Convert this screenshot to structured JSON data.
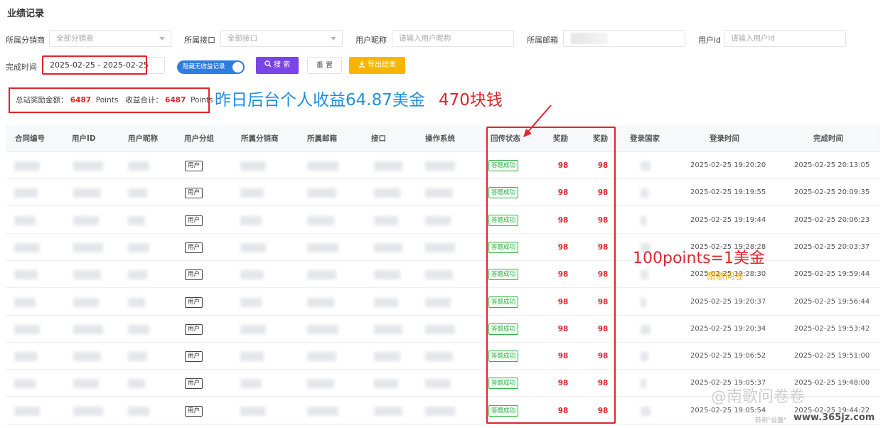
{
  "page_title": "业绩记录",
  "filters": {
    "distributor_label": "所属分销商",
    "distributor_value": "全部分销商",
    "interface_label": "所属接口",
    "interface_value": "全部接口",
    "nickname_label": "用户昵称",
    "nickname_placeholder": "请输入用户昵称",
    "email_label": "所属邮箱",
    "userid_label": "用户id",
    "userid_placeholder": "请输入用户id",
    "finish_time_label": "完成时间",
    "date_range": "2025-02-25 - 2025-02-25",
    "toggle_label": "隐藏无收益记录",
    "search_button": "搜 索",
    "reset_button": "重 置",
    "export_button": "导出结果"
  },
  "summary": {
    "total_label": "总站奖励金额：",
    "total_value": "6487",
    "total_unit": "Points",
    "income_label": "收益合计：",
    "income_value": "6487",
    "income_unit": "Points"
  },
  "annotations": {
    "blue_note": "昨日后台个人收益64.87美金",
    "red_note": "470块钱",
    "points_note": "100points=1美金"
  },
  "watermarks": {
    "small": "南歌问卷",
    "big": "@南歌问卷卷",
    "site": "www.365jz.com",
    "hint": "转到\"设置\""
  },
  "table": {
    "headers": [
      "合同编号",
      "用户ID",
      "用户昵称",
      "用户分组",
      "所属分销商",
      "所属邮箱",
      "接口",
      "操作系统",
      "回传状态",
      "奖励",
      "奖励",
      "登录国家",
      "登录时间",
      "完成时间"
    ],
    "rows": [
      {
        "group": "用户",
        "status": "答题成功",
        "reward1": "98",
        "reward2": "98",
        "login": "2025-02-25 19:20:20",
        "finish": "2025-02-25 20:13:05"
      },
      {
        "group": "用户",
        "status": "答题成功",
        "reward1": "98",
        "reward2": "98",
        "login": "2025-02-25 19:19:55",
        "finish": "2025-02-25 20:09:35"
      },
      {
        "group": "用户",
        "status": "答题成功",
        "reward1": "98",
        "reward2": "98",
        "login": "2025-02-25 19:19:44",
        "finish": "2025-02-25 20:06:23"
      },
      {
        "group": "用户",
        "status": "答题成功",
        "reward1": "98",
        "reward2": "98",
        "login": "2025-02-25 19:28:28",
        "finish": "2025-02-25 20:03:37"
      },
      {
        "group": "用户",
        "status": "答题成功",
        "reward1": "98",
        "reward2": "98",
        "login": "2025-02-25 19:28:30",
        "finish": "2025-02-25 19:59:44"
      },
      {
        "group": "用户",
        "status": "答题成功",
        "reward1": "98",
        "reward2": "98",
        "login": "2025-02-25 19:20:37",
        "finish": "2025-02-25 19:56:44"
      },
      {
        "group": "用户",
        "status": "答题成功",
        "reward1": "98",
        "reward2": "98",
        "login": "2025-02-25 19:20:34",
        "finish": "2025-02-25 19:53:42"
      },
      {
        "group": "用户",
        "status": "答题成功",
        "reward1": "98",
        "reward2": "98",
        "login": "2025-02-25 19:06:52",
        "finish": "2025-02-25 19:51:00"
      },
      {
        "group": "用户",
        "status": "答题成功",
        "reward1": "98",
        "reward2": "98",
        "login": "2025-02-25 19:05:37",
        "finish": "2025-02-25 19:48:00"
      },
      {
        "group": "用户",
        "status": "答题成功",
        "reward1": "98",
        "reward2": "98",
        "login": "2025-02-25 19:05:54",
        "finish": "2025-02-25 19:44:22"
      }
    ]
  },
  "colors": {
    "accent_red": "#e0252c",
    "blue_note": "#1f8fe0",
    "search_purple": "#7a44e6",
    "export_yellow": "#f7b500",
    "toggle_blue": "#2f7de1",
    "success_green": "#38b24d"
  }
}
